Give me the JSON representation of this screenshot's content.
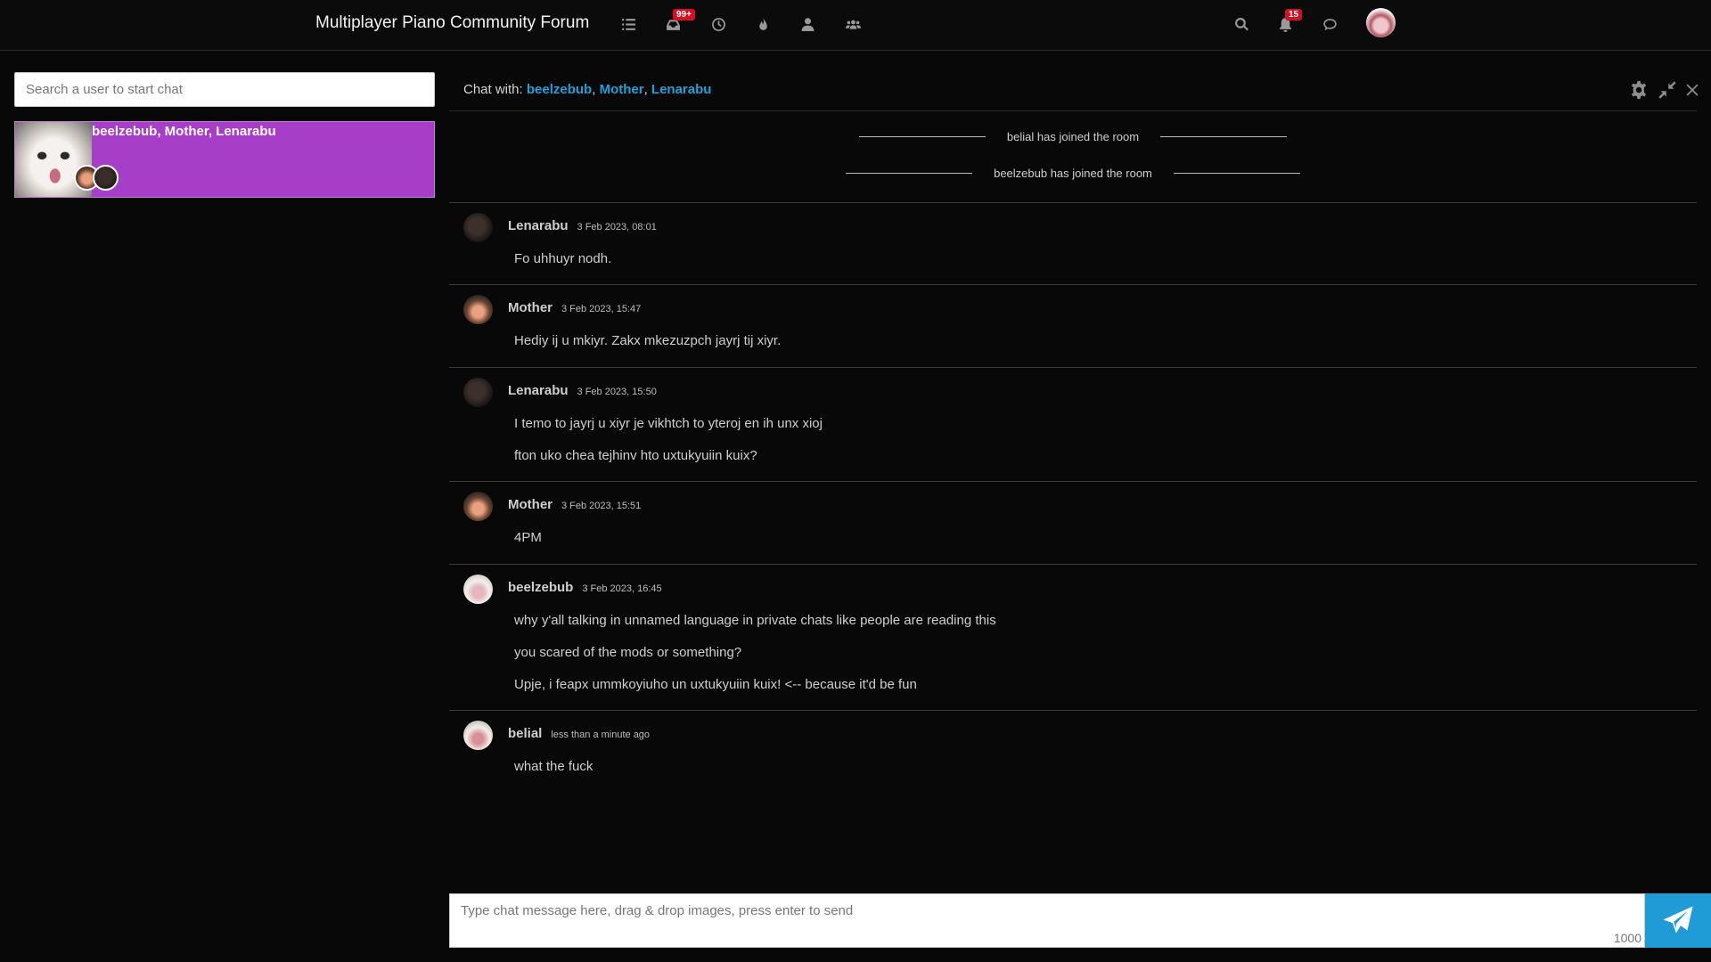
{
  "navbar": {
    "brand": "Multiplayer Piano Community Forum",
    "icons": [
      "list-icon",
      "inbox-icon",
      "clock-icon",
      "fire-icon",
      "user-icon",
      "users-icon"
    ],
    "inbox_badge": "99+",
    "notification_badge": "15",
    "right_icons": [
      "search-icon",
      "bell-icon",
      "chat-icon"
    ]
  },
  "sidebar": {
    "search_placeholder": "Search a user to start chat",
    "rooms": [
      {
        "names": "beelzebub, Mother, Lenarabu"
      }
    ]
  },
  "chat": {
    "header_prefix": "Chat with: ",
    "participants": [
      "beelzebub",
      "Mother",
      "Lenarabu"
    ],
    "separator": ", ",
    "system_messages": [
      "belial has joined the room",
      "beelzebub has joined the room"
    ],
    "groups": [
      {
        "user": "Lenarabu",
        "time": "3 Feb 2023, 08:01",
        "lines": [
          "Fo uhhuyr nodh."
        ]
      },
      {
        "user": "Mother",
        "time": "3 Feb 2023, 15:47",
        "lines": [
          "Hediy ij u mkiyr. Zakx mkezuzpch jayrj tij xiyr."
        ]
      },
      {
        "user": "Lenarabu",
        "time": "3 Feb 2023, 15:50",
        "lines": [
          "I temo to jayrj u xiyr je vikhtch to yteroj en ih unx xioj",
          "fton uko chea tejhinv hto uxtukyuiin kuix?"
        ]
      },
      {
        "user": "Mother",
        "time": "3 Feb 2023, 15:51",
        "lines": [
          "4PM"
        ]
      },
      {
        "user": "beelzebub",
        "time": "3 Feb 2023, 16:45",
        "lines": [
          "why y'all talking in unnamed language in private chats like people are reading this",
          "you scared of the mods or something?",
          "Upje, i feapx ummkoyiuho un uxtukyuiin kuix! <-- because it'd be fun"
        ]
      },
      {
        "user": "belial",
        "time": "less than a minute ago",
        "lines": [
          "what the fuck"
        ]
      }
    ]
  },
  "composer": {
    "placeholder": "Type chat message here, drag & drop images, press enter to send",
    "char_limit": "1000"
  },
  "colors": {
    "accent": "#1f9bd6",
    "room_active": "#a73ec7",
    "badge": "#d40f24"
  }
}
